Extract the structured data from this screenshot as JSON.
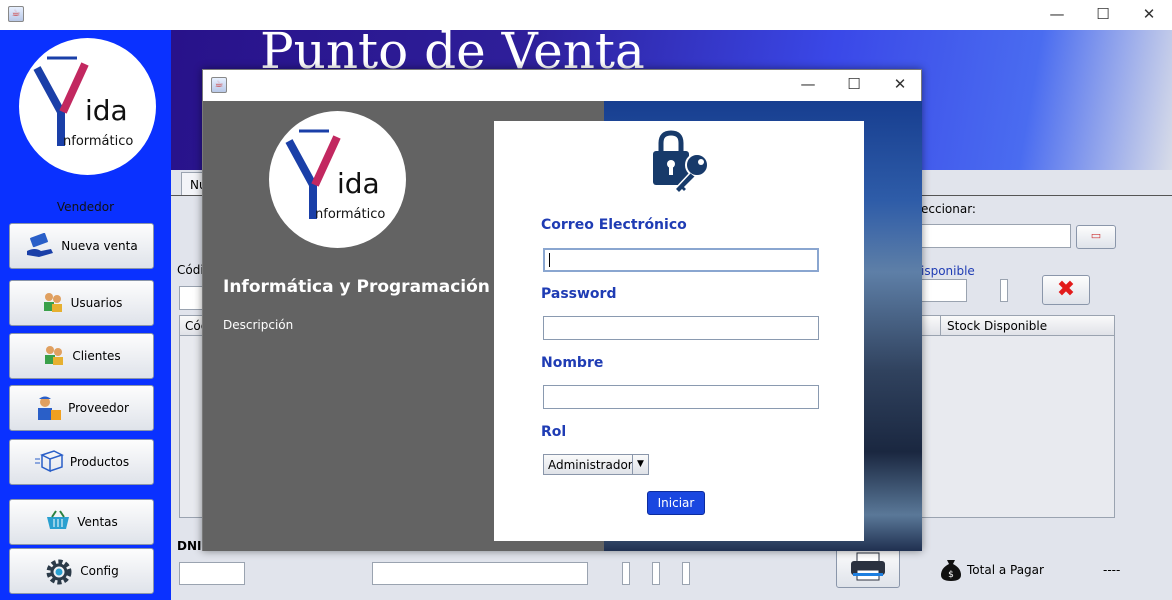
{
  "window": {
    "minimize": "—",
    "maximize": "☐",
    "close": "✕"
  },
  "header": {
    "title": "Punto de Venta"
  },
  "logo": {
    "text1": "ida",
    "text2": "nformático"
  },
  "sidebar": {
    "role_label": "Vendedor",
    "items": [
      {
        "label": "Nueva venta",
        "icon": "cash-hand-icon"
      },
      {
        "label": "Usuarios",
        "icon": "users-icon"
      },
      {
        "label": "Clientes",
        "icon": "clients-icon"
      },
      {
        "label": "Proveedor",
        "icon": "supplier-icon"
      },
      {
        "label": "Productos",
        "icon": "box-icon"
      },
      {
        "label": "Ventas",
        "icon": "basket-icon"
      },
      {
        "label": "Config",
        "icon": "gear-icon"
      }
    ]
  },
  "main": {
    "tab_label": "Nu",
    "codigo_label": "Códi",
    "table_col_first": "Cód",
    "seleccionar_label": "eccionar:",
    "disponible_label": "isponible",
    "table_col_stock": "Stock Disponible",
    "dni_label": "DNI",
    "total_label": "Total a Pagar",
    "total_value": "----"
  },
  "dialog": {
    "minimize": "—",
    "maximize": "☐",
    "close": "✕",
    "heading": "Informática y Programación",
    "description": "Descripción",
    "email_label": "Correo Electrónico",
    "email_value": "",
    "password_label": "Password",
    "nombre_label": "Nombre",
    "rol_label": "Rol",
    "rol_value": "Administrador",
    "submit_label": "Iniciar"
  },
  "colors": {
    "sidebar": "#0a31ff",
    "label_blue": "#1f3cb4",
    "button_blue": "#1a47e0",
    "dialog_left": "#636363"
  }
}
